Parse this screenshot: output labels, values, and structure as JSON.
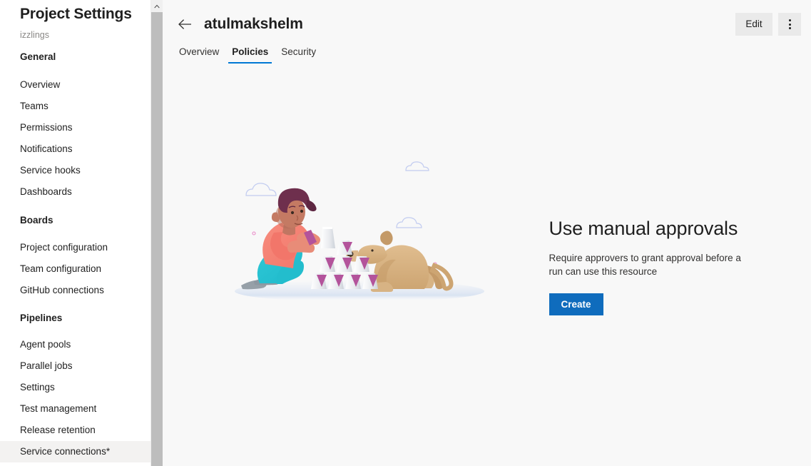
{
  "sidebar": {
    "title": "Project Settings",
    "subtitle": "izzlings",
    "scroll_up_icon": "chevron-up-icon",
    "groups": [
      {
        "heading": "General",
        "items": [
          {
            "label": "Overview",
            "selected": false
          },
          {
            "label": "Teams",
            "selected": false
          },
          {
            "label": "Permissions",
            "selected": false
          },
          {
            "label": "Notifications",
            "selected": false
          },
          {
            "label": "Service hooks",
            "selected": false
          },
          {
            "label": "Dashboards",
            "selected": false
          }
        ]
      },
      {
        "heading": "Boards",
        "items": [
          {
            "label": "Project configuration",
            "selected": false
          },
          {
            "label": "Team configuration",
            "selected": false
          },
          {
            "label": "GitHub connections",
            "selected": false
          }
        ]
      },
      {
        "heading": "Pipelines",
        "items": [
          {
            "label": "Agent pools",
            "selected": false
          },
          {
            "label": "Parallel jobs",
            "selected": false
          },
          {
            "label": "Settings",
            "selected": false
          },
          {
            "label": "Test management",
            "selected": false
          },
          {
            "label": "Release retention",
            "selected": false
          },
          {
            "label": "Service connections*",
            "selected": true
          }
        ]
      }
    ]
  },
  "header": {
    "back_icon": "arrow-left-icon",
    "title": "atulmakshelm",
    "edit_label": "Edit",
    "more_icon": "more-vertical-icon"
  },
  "tabs": [
    {
      "label": "Overview",
      "active": false
    },
    {
      "label": "Policies",
      "active": true
    },
    {
      "label": "Security",
      "active": false
    }
  ],
  "empty_state": {
    "illustration_name": "person-building-card-tower-with-dog-illustration",
    "heading": "Use manual approvals",
    "description": "Require approvers to grant approval before a run can use this resource",
    "create_label": "Create"
  },
  "colors": {
    "accent": "#0078d4",
    "primary_button": "#0f6cbd",
    "page_background": "#f8f8f8",
    "sidebar_background": "#ffffff",
    "selected_item": "#f3f2f1",
    "muted_text": "#8a8886",
    "scrollbar_thumb": "#bdbdbd"
  }
}
